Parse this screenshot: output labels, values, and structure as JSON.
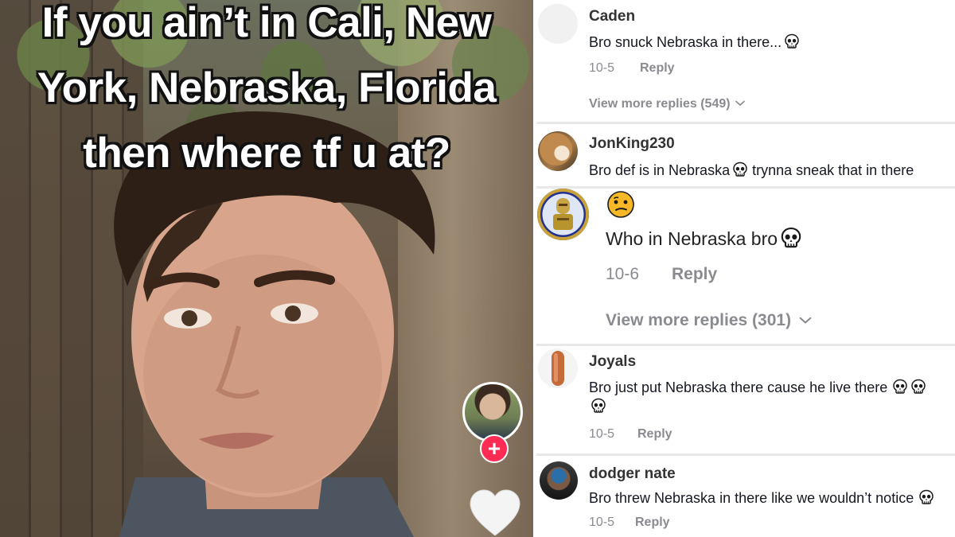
{
  "video": {
    "caption_lines": [
      "If you ain’t in Cali, New",
      "York, Nebraska, Florida",
      "then where tf u at?"
    ],
    "follow_icon": "plus-icon",
    "like_icon": "heart-icon",
    "accent_color": "#fe2c55"
  },
  "comments": [
    {
      "username": "Caden",
      "text": "Bro snuck Nebraska in there...",
      "emoji": [
        "skull"
      ],
      "date": "10-5",
      "reply_label": "Reply",
      "view_replies": "View more replies (549)"
    },
    {
      "username": "JonKing230",
      "text": "Bro def is in Nebraska",
      "emoji_inline": "skull",
      "text_after": "trynna sneak that in there"
    },
    {
      "username": "",
      "reaction_emoji": "confused-face",
      "text": "Who in Nebraska bro",
      "emoji": [
        "skull"
      ],
      "date": "10-6",
      "reply_label": "Reply",
      "view_replies": "View more replies (301)"
    },
    {
      "username": "Joyals",
      "text": "Bro just put Nebraska there cause he live there",
      "emoji": [
        "skull",
        "skull",
        "skull"
      ],
      "date": "10-5",
      "reply_label": "Reply"
    },
    {
      "username": "dodger nate",
      "text": "Bro threw Nebraska in there like we wouldn’t notice",
      "emoji": [
        "skull"
      ],
      "date": "10-5",
      "reply_label": "Reply"
    }
  ],
  "colors": {
    "meta_text": "#8a8b91",
    "username": "#333333",
    "body_text": "#161823",
    "separator": "#e8e8e8"
  }
}
